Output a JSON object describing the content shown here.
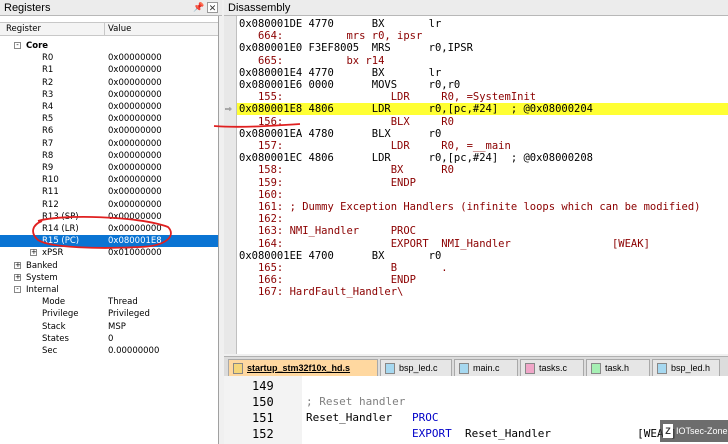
{
  "registers_title": "Registers",
  "disassembly_title": "Disassembly",
  "reg_headers": {
    "register": "Register",
    "value": "Value"
  },
  "core_label": "Core",
  "core_regs": [
    {
      "name": "R0",
      "value": "0x00000000"
    },
    {
      "name": "R1",
      "value": "0x00000000"
    },
    {
      "name": "R2",
      "value": "0x00000000"
    },
    {
      "name": "R3",
      "value": "0x00000000"
    },
    {
      "name": "R4",
      "value": "0x00000000"
    },
    {
      "name": "R5",
      "value": "0x00000000"
    },
    {
      "name": "R6",
      "value": "0x00000000"
    },
    {
      "name": "R7",
      "value": "0x00000000"
    },
    {
      "name": "R8",
      "value": "0x00000000"
    },
    {
      "name": "R9",
      "value": "0x00000000"
    },
    {
      "name": "R10",
      "value": "0x00000000"
    },
    {
      "name": "R11",
      "value": "0x00000000"
    },
    {
      "name": "R12",
      "value": "0x00000000"
    },
    {
      "name": "R13 (SP)",
      "value": "0x00000000"
    },
    {
      "name": "R14 (LR)",
      "value": "0x00000000"
    },
    {
      "name": "R15 (PC)",
      "value": "0x080001E8"
    },
    {
      "name": "xPSR",
      "value": "0x01000000"
    }
  ],
  "groups": {
    "banked": "Banked",
    "system": "System",
    "internal": "Internal"
  },
  "internal_regs": [
    {
      "name": "Mode",
      "value": "Thread"
    },
    {
      "name": "Privilege",
      "value": "Privileged"
    },
    {
      "name": "Stack",
      "value": "MSP"
    },
    {
      "name": "States",
      "value": "0"
    },
    {
      "name": "Sec",
      "value": "0.00000000"
    }
  ],
  "disasm": [
    {
      "kind": "asm",
      "text": "0x080001DE 4770      BX       lr"
    },
    {
      "kind": "src",
      "text": "   664:          mrs r0, ipsr"
    },
    {
      "kind": "asm",
      "text": "0x080001E0 F3EF8005  MRS      r0,IPSR"
    },
    {
      "kind": "src",
      "text": "   665:          bx r14"
    },
    {
      "kind": "asm",
      "text": "0x080001E4 4770      BX       lr"
    },
    {
      "kind": "asm",
      "text": "0x080001E6 0000      MOVS     r0,r0"
    },
    {
      "kind": "src",
      "text": "   155:                 LDR     R0, =SystemInit"
    },
    {
      "kind": "cur",
      "text": "0x080001E8 4806      LDR      r0,[pc,#24]  ; @0x08000204"
    },
    {
      "kind": "src",
      "text": "   156:                 BLX     R0"
    },
    {
      "kind": "asm",
      "text": "0x080001EA 4780      BLX      r0"
    },
    {
      "kind": "src",
      "text": "   157:                 LDR     R0, =__main"
    },
    {
      "kind": "asm",
      "text": "0x080001EC 4806      LDR      r0,[pc,#24]  ; @0x08000208"
    },
    {
      "kind": "src",
      "text": "   158:                 BX      R0"
    },
    {
      "kind": "src",
      "text": "   159:                 ENDP"
    },
    {
      "kind": "src",
      "text": "   160:"
    },
    {
      "kind": "src",
      "text": "   161: ; Dummy Exception Handlers (infinite loops which can be modified)"
    },
    {
      "kind": "src",
      "text": "   162:"
    },
    {
      "kind": "src",
      "text": "   163: NMI_Handler     PROC"
    },
    {
      "kind": "src",
      "text": "   164:                 EXPORT  NMI_Handler                [WEAK]"
    },
    {
      "kind": "asm",
      "text": "0x080001EE 4700      BX       r0"
    },
    {
      "kind": "src",
      "text": "   165:                 B       ."
    },
    {
      "kind": "src",
      "text": "   166:                 ENDP"
    },
    {
      "kind": "src",
      "text": "   167: HardFault_Handler\\"
    }
  ],
  "tabs": [
    {
      "label": "startup_stm32f10x_hd.s",
      "active": true,
      "icon_color": "#f5d67a"
    },
    {
      "label": "bsp_led.c",
      "active": false,
      "icon_color": "#a6d8f0"
    },
    {
      "label": "main.c",
      "active": false,
      "icon_color": "#a6d8f0"
    },
    {
      "label": "tasks.c",
      "active": false,
      "icon_color": "#f0a6c8"
    },
    {
      "label": "task.h",
      "active": false,
      "icon_color": "#a6f0b4"
    },
    {
      "label": "bsp_led.h",
      "active": false,
      "icon_color": "#a6d8f0"
    }
  ],
  "editor": [
    {
      "line": "149",
      "code": ""
    },
    {
      "line": "150",
      "code": "; Reset handler"
    },
    {
      "line": "151",
      "code": "Reset_Handler   PROC"
    },
    {
      "line": "152",
      "code": "                EXPORT  Reset_Handler             [WEAK]"
    }
  ],
  "watermark": "IOTsec-Zone",
  "colors": {
    "current_line": "#ffff33",
    "selection": "#0a74d3",
    "annotation": "#e02020"
  }
}
